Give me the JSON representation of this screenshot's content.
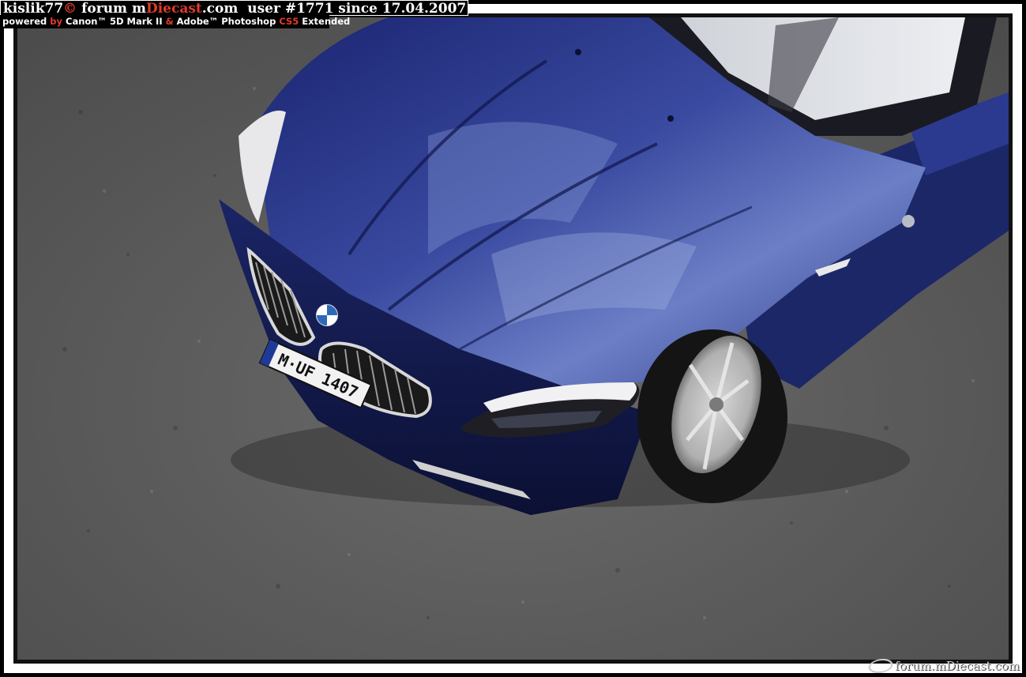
{
  "header": {
    "user": "kislik77",
    "copyright": "©",
    "forum_prefix": " forum m",
    "forum_brand": "Diecast",
    "forum_suffix": ".com",
    "user_label": "  user #1771 since 17.04.2007",
    "powered_prefix": "powered ",
    "powered_by": "by",
    "camera": " Canon™ 5D Mark II ",
    "amp": "&",
    "software": " Adobe™ Photoshop ",
    "cs5": "CS5",
    "extended": " Extended"
  },
  "photo": {
    "license_plate": "M·UF 1407"
  },
  "watermark": {
    "text": "forum.mDiecast.com"
  },
  "colors": {
    "car_blue": "#1d2a6e",
    "accent_red": "#e03b2a",
    "asphalt": "#5e5e5e"
  }
}
